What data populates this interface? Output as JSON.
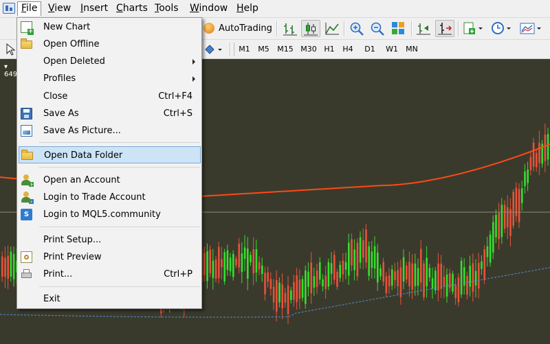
{
  "menubar": {
    "items": [
      {
        "pre": "",
        "ul": "F",
        "post": "ile"
      },
      {
        "pre": "",
        "ul": "V",
        "post": "iew"
      },
      {
        "pre": "",
        "ul": "I",
        "post": "nsert"
      },
      {
        "pre": "",
        "ul": "C",
        "post": "harts"
      },
      {
        "pre": "",
        "ul": "T",
        "post": "ools"
      },
      {
        "pre": "",
        "ul": "W",
        "post": "indow"
      },
      {
        "pre": "",
        "ul": "H",
        "post": "elp"
      }
    ]
  },
  "toolbar": {
    "autotrading_label": "AutoTrading",
    "timeframes": [
      "M1",
      "M5",
      "M15",
      "M30",
      "H1",
      "H4",
      "D1",
      "W1",
      "MN"
    ]
  },
  "chart": {
    "price_label": "649",
    "colors": {
      "background": "#3a3a2c",
      "bull": "#33e02c",
      "bear": "#e8523a",
      "ma": "#ff4a14",
      "dotted": "#4a8fd8",
      "hline": "#8a8f7a"
    }
  },
  "file_menu": {
    "items": [
      {
        "label": "New Chart",
        "shortcut": "",
        "submenu": false,
        "icon": "new-chart-icon"
      },
      {
        "label": "Open Offline",
        "shortcut": "",
        "submenu": false,
        "icon": "folder-icon"
      },
      {
        "label": "Open Deleted",
        "shortcut": "",
        "submenu": true,
        "icon": ""
      },
      {
        "label": "Profiles",
        "shortcut": "",
        "submenu": true,
        "icon": ""
      },
      {
        "label": "Close",
        "shortcut": "Ctrl+F4",
        "submenu": false,
        "icon": ""
      },
      {
        "label": "Save As",
        "shortcut": "Ctrl+S",
        "submenu": false,
        "icon": "save-disk-icon"
      },
      {
        "label": "Save As Picture...",
        "shortcut": "",
        "submenu": false,
        "icon": "picture-icon"
      },
      {
        "label": "Open Data Folder",
        "shortcut": "",
        "submenu": false,
        "icon": "folder-icon",
        "highlighted": true
      },
      {
        "label": "Open an Account",
        "shortcut": "",
        "submenu": false,
        "icon": "account-add-icon"
      },
      {
        "label": "Login to Trade Account",
        "shortcut": "",
        "submenu": false,
        "icon": "account-login-icon"
      },
      {
        "label": "Login to MQL5.community",
        "shortcut": "",
        "submenu": false,
        "icon": "mql5-icon"
      },
      {
        "label": "Print Setup...",
        "shortcut": "",
        "submenu": false,
        "icon": ""
      },
      {
        "label": "Print Preview",
        "shortcut": "",
        "submenu": false,
        "icon": "print-preview-icon"
      },
      {
        "label": "Print...",
        "shortcut": "Ctrl+P",
        "submenu": false,
        "icon": "printer-icon"
      },
      {
        "label": "Exit",
        "shortcut": "",
        "submenu": false,
        "icon": ""
      }
    ]
  }
}
